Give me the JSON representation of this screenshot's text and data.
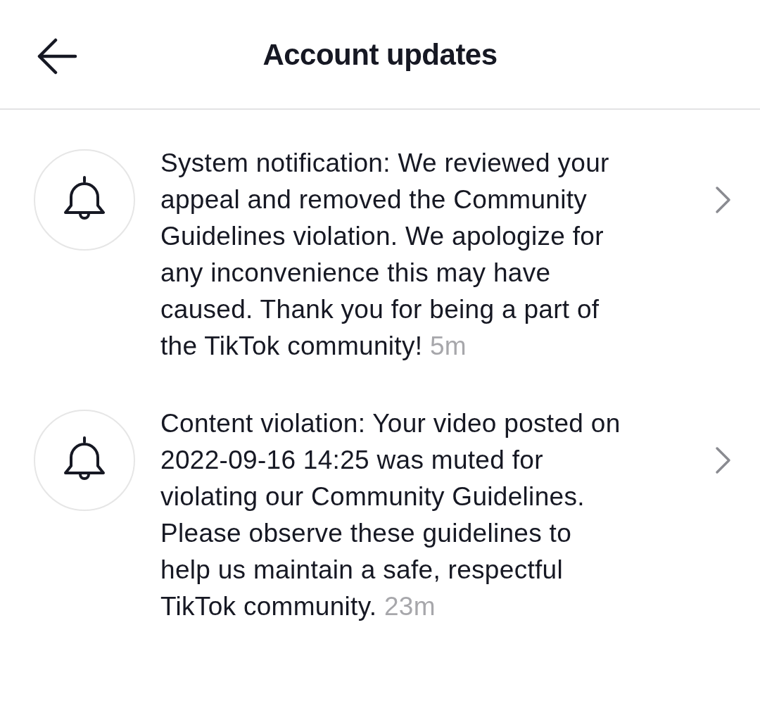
{
  "header": {
    "title": "Account updates"
  },
  "notifications": [
    {
      "message": "System notification: We reviewed your appeal and removed the Community Guidelines violation. We apologize for any inconvenience this may have caused. Thank you for being a part of the TikTok community!",
      "time": "5m"
    },
    {
      "message": "Content violation: Your video posted on 2022-09-16 14:25 was muted for violating our Community Guidelines. Please observe these guidelines to help us maintain a safe, respectful TikTok community.",
      "time": "23m"
    }
  ]
}
